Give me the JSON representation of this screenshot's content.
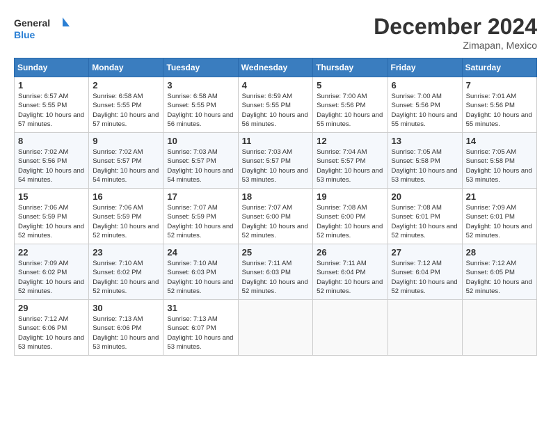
{
  "logo": {
    "text_general": "General",
    "text_blue": "Blue"
  },
  "header": {
    "month_year": "December 2024",
    "location": "Zimapan, Mexico"
  },
  "weekdays": [
    "Sunday",
    "Monday",
    "Tuesday",
    "Wednesday",
    "Thursday",
    "Friday",
    "Saturday"
  ],
  "weeks": [
    [
      {
        "day": "1",
        "sunrise": "6:57 AM",
        "sunset": "5:55 PM",
        "daylight": "10 hours and 57 minutes."
      },
      {
        "day": "2",
        "sunrise": "6:58 AM",
        "sunset": "5:55 PM",
        "daylight": "10 hours and 57 minutes."
      },
      {
        "day": "3",
        "sunrise": "6:58 AM",
        "sunset": "5:55 PM",
        "daylight": "10 hours and 56 minutes."
      },
      {
        "day": "4",
        "sunrise": "6:59 AM",
        "sunset": "5:55 PM",
        "daylight": "10 hours and 56 minutes."
      },
      {
        "day": "5",
        "sunrise": "7:00 AM",
        "sunset": "5:56 PM",
        "daylight": "10 hours and 55 minutes."
      },
      {
        "day": "6",
        "sunrise": "7:00 AM",
        "sunset": "5:56 PM",
        "daylight": "10 hours and 55 minutes."
      },
      {
        "day": "7",
        "sunrise": "7:01 AM",
        "sunset": "5:56 PM",
        "daylight": "10 hours and 55 minutes."
      }
    ],
    [
      {
        "day": "8",
        "sunrise": "7:02 AM",
        "sunset": "5:56 PM",
        "daylight": "10 hours and 54 minutes."
      },
      {
        "day": "9",
        "sunrise": "7:02 AM",
        "sunset": "5:57 PM",
        "daylight": "10 hours and 54 minutes."
      },
      {
        "day": "10",
        "sunrise": "7:03 AM",
        "sunset": "5:57 PM",
        "daylight": "10 hours and 54 minutes."
      },
      {
        "day": "11",
        "sunrise": "7:03 AM",
        "sunset": "5:57 PM",
        "daylight": "10 hours and 53 minutes."
      },
      {
        "day": "12",
        "sunrise": "7:04 AM",
        "sunset": "5:57 PM",
        "daylight": "10 hours and 53 minutes."
      },
      {
        "day": "13",
        "sunrise": "7:05 AM",
        "sunset": "5:58 PM",
        "daylight": "10 hours and 53 minutes."
      },
      {
        "day": "14",
        "sunrise": "7:05 AM",
        "sunset": "5:58 PM",
        "daylight": "10 hours and 53 minutes."
      }
    ],
    [
      {
        "day": "15",
        "sunrise": "7:06 AM",
        "sunset": "5:59 PM",
        "daylight": "10 hours and 52 minutes."
      },
      {
        "day": "16",
        "sunrise": "7:06 AM",
        "sunset": "5:59 PM",
        "daylight": "10 hours and 52 minutes."
      },
      {
        "day": "17",
        "sunrise": "7:07 AM",
        "sunset": "5:59 PM",
        "daylight": "10 hours and 52 minutes."
      },
      {
        "day": "18",
        "sunrise": "7:07 AM",
        "sunset": "6:00 PM",
        "daylight": "10 hours and 52 minutes."
      },
      {
        "day": "19",
        "sunrise": "7:08 AM",
        "sunset": "6:00 PM",
        "daylight": "10 hours and 52 minutes."
      },
      {
        "day": "20",
        "sunrise": "7:08 AM",
        "sunset": "6:01 PM",
        "daylight": "10 hours and 52 minutes."
      },
      {
        "day": "21",
        "sunrise": "7:09 AM",
        "sunset": "6:01 PM",
        "daylight": "10 hours and 52 minutes."
      }
    ],
    [
      {
        "day": "22",
        "sunrise": "7:09 AM",
        "sunset": "6:02 PM",
        "daylight": "10 hours and 52 minutes."
      },
      {
        "day": "23",
        "sunrise": "7:10 AM",
        "sunset": "6:02 PM",
        "daylight": "10 hours and 52 minutes."
      },
      {
        "day": "24",
        "sunrise": "7:10 AM",
        "sunset": "6:03 PM",
        "daylight": "10 hours and 52 minutes."
      },
      {
        "day": "25",
        "sunrise": "7:11 AM",
        "sunset": "6:03 PM",
        "daylight": "10 hours and 52 minutes."
      },
      {
        "day": "26",
        "sunrise": "7:11 AM",
        "sunset": "6:04 PM",
        "daylight": "10 hours and 52 minutes."
      },
      {
        "day": "27",
        "sunrise": "7:12 AM",
        "sunset": "6:04 PM",
        "daylight": "10 hours and 52 minutes."
      },
      {
        "day": "28",
        "sunrise": "7:12 AM",
        "sunset": "6:05 PM",
        "daylight": "10 hours and 52 minutes."
      }
    ],
    [
      {
        "day": "29",
        "sunrise": "7:12 AM",
        "sunset": "6:06 PM",
        "daylight": "10 hours and 53 minutes."
      },
      {
        "day": "30",
        "sunrise": "7:13 AM",
        "sunset": "6:06 PM",
        "daylight": "10 hours and 53 minutes."
      },
      {
        "day": "31",
        "sunrise": "7:13 AM",
        "sunset": "6:07 PM",
        "daylight": "10 hours and 53 minutes."
      },
      null,
      null,
      null,
      null
    ]
  ],
  "labels": {
    "sunrise": "Sunrise: ",
    "sunset": "Sunset: ",
    "daylight": "Daylight: "
  }
}
